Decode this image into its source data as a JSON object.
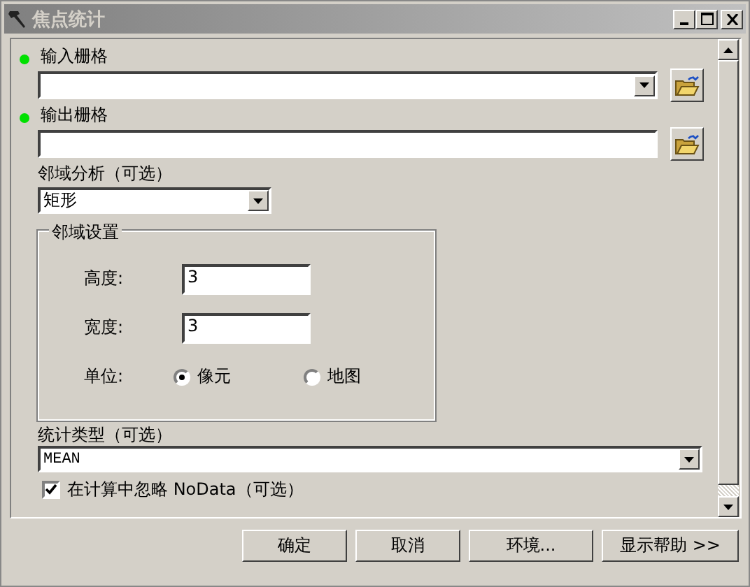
{
  "window": {
    "title": "焦点统计"
  },
  "input_raster": {
    "label": "输入栅格",
    "required": true
  },
  "output_raster": {
    "label": "输出栅格",
    "required": true
  },
  "neighborhood": {
    "label": "邻域分析（可选）",
    "value": "矩形"
  },
  "neighborhood_settings": {
    "title": "邻域设置",
    "height": {
      "label": "高度:",
      "value": "3"
    },
    "width": {
      "label": "宽度:",
      "value": "3"
    },
    "units": {
      "label": "单位:",
      "options": [
        {
          "label": "像元",
          "selected": true
        },
        {
          "label": "地图",
          "selected": false
        }
      ]
    }
  },
  "statistics_type": {
    "label": "统计类型（可选）",
    "value": "MEAN"
  },
  "ignore_nodata": {
    "label": "在计算中忽略 NoData（可选）",
    "checked": true
  },
  "buttons": [
    "确定",
    "取消",
    "环境...",
    "显示帮助 >>"
  ]
}
